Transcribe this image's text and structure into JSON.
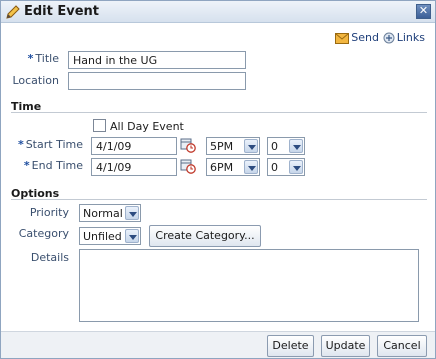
{
  "dialog": {
    "title": "Edit Event",
    "close_label": "✕"
  },
  "toplinks": {
    "send_label": "Send",
    "links_label": "Links"
  },
  "form": {
    "title_label": "Title",
    "title_value": "Hand in the UG",
    "location_label": "Location",
    "location_value": "",
    "required_marker": "*"
  },
  "time": {
    "section_label": "Time",
    "all_day_label": "All Day Event",
    "start_label": "Start Time",
    "start_date": "4/1/09",
    "start_hour": "5PM",
    "start_minute": "0",
    "end_label": "End Time",
    "end_date": "4/1/09",
    "end_hour": "6PM",
    "end_minute": "0"
  },
  "options": {
    "section_label": "Options",
    "priority_label": "Priority",
    "priority_value": "Normal",
    "category_label": "Category",
    "category_value": "Unfiled",
    "create_category_label": "Create Category...",
    "details_label": "Details",
    "details_value": ""
  },
  "footer": {
    "delete_label": "Delete",
    "update_label": "Update",
    "cancel_label": "Cancel"
  }
}
